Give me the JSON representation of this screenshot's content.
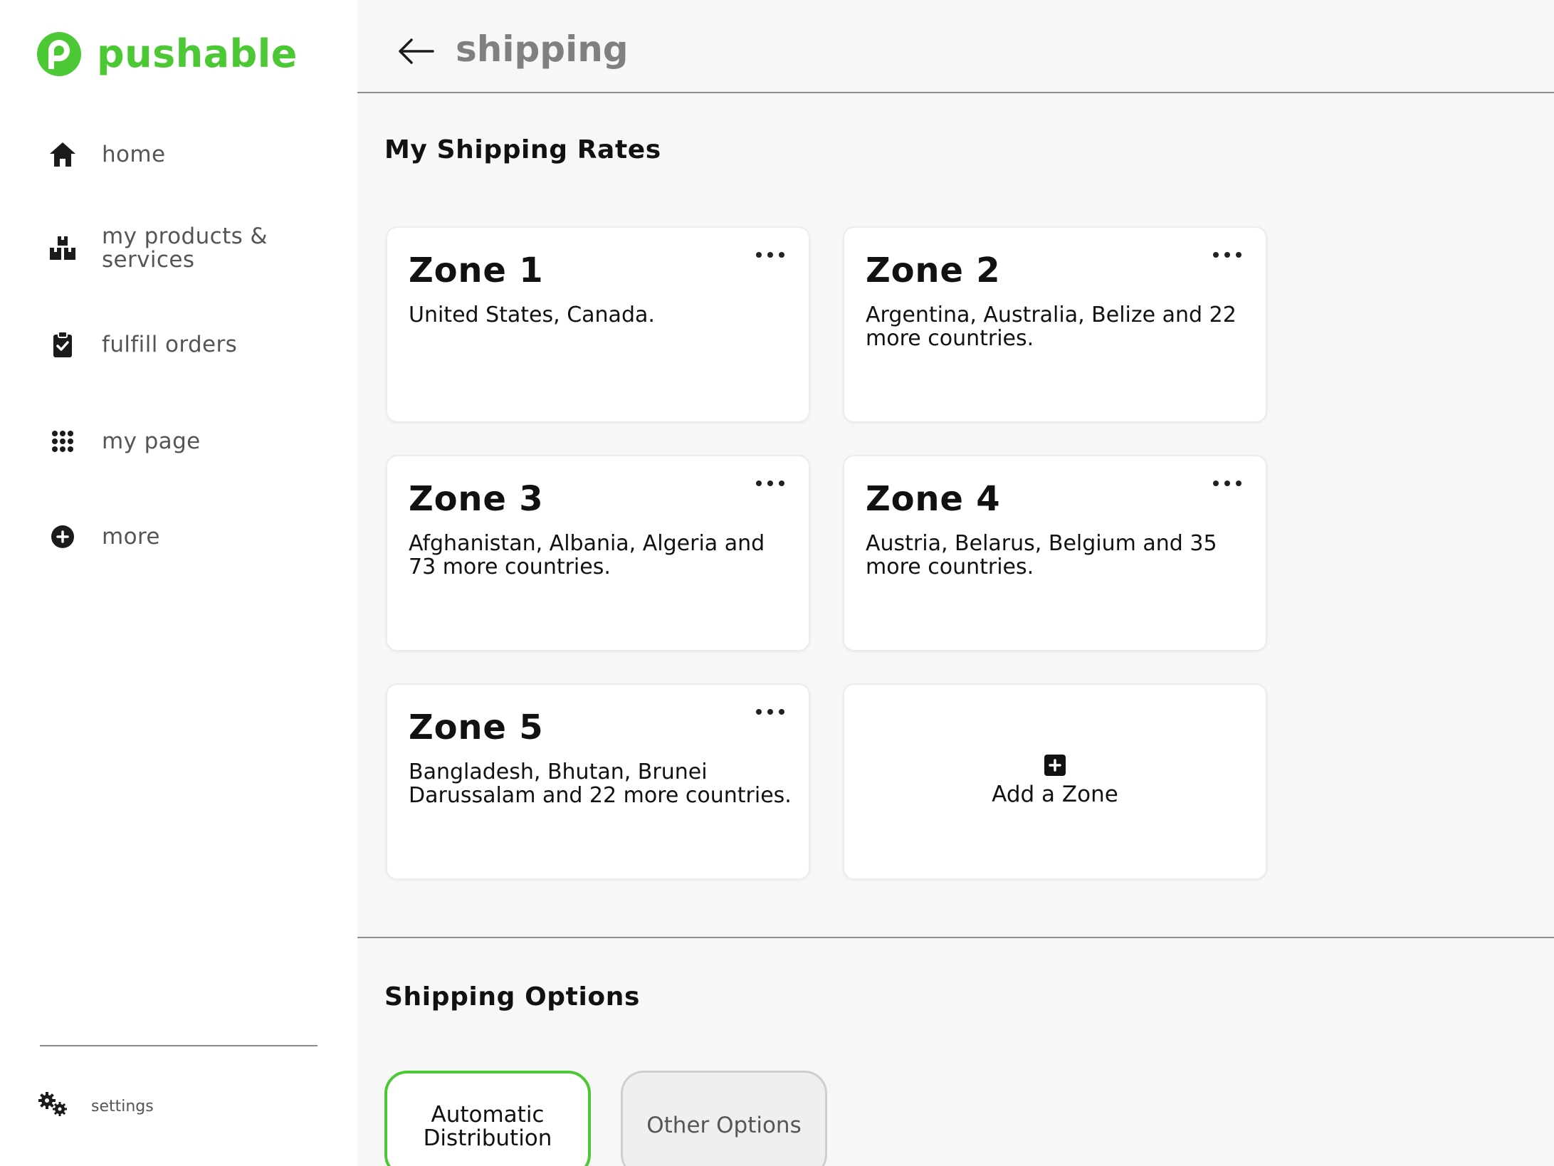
{
  "brand": {
    "name": "pushable",
    "color": "#4cc835"
  },
  "sidebar": {
    "items": [
      {
        "id": "home",
        "label": "home",
        "icon": "home-icon"
      },
      {
        "id": "products",
        "label": "my products & services",
        "icon": "boxes-icon"
      },
      {
        "id": "fulfill",
        "label": "fulfill orders",
        "icon": "clipboard-check-icon"
      },
      {
        "id": "mypage",
        "label": "my page",
        "icon": "grid-icon"
      },
      {
        "id": "more",
        "label": "more",
        "icon": "plus-circle-icon"
      }
    ],
    "settings_label": "settings"
  },
  "header": {
    "title": "shipping"
  },
  "rates": {
    "title": "My Shipping Rates",
    "zones": [
      {
        "name": "Zone 1",
        "countries": "United States, Canada."
      },
      {
        "name": "Zone 2",
        "countries": "Argentina, Australia, Belize and 22 more countries."
      },
      {
        "name": "Zone 3",
        "countries": "Afghanistan, Albania, Algeria and 73 more countries."
      },
      {
        "name": "Zone 4",
        "countries": "Austria, Belarus, Belgium and 35 more countries."
      },
      {
        "name": "Zone 5",
        "countries": "Bangladesh, Bhutan, Brunei Darussalam and 22 more countries."
      }
    ],
    "add_label": "Add a Zone"
  },
  "options": {
    "title": "Shipping Options",
    "buttons": [
      {
        "label": "Automatic Distribution",
        "selected": true
      },
      {
        "label": "Other Options",
        "selected": false
      }
    ]
  }
}
